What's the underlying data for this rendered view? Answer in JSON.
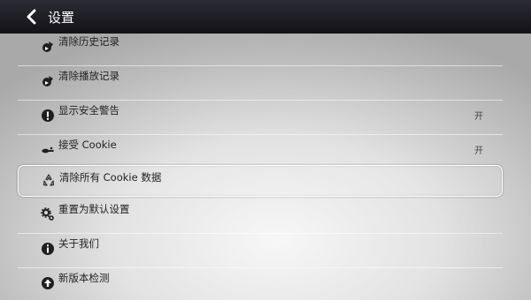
{
  "header": {
    "title": "设置",
    "back_icon": "chevron-left-icon"
  },
  "settings": {
    "items": [
      {
        "label": "清除历史记录",
        "sublabel": "",
        "value": "",
        "icon": "trash-icon"
      },
      {
        "label": "清除播放记录",
        "sublabel": "",
        "value": "",
        "icon": "trash-icon"
      },
      {
        "label": "显示安全警告",
        "sublabel": "",
        "value": "开",
        "icon": "alert-icon"
      },
      {
        "label": "接受 Cookie",
        "sublabel": "",
        "value": "开",
        "icon": "cookie-icon"
      },
      {
        "label": "清除所有 Cookie 数据",
        "sublabel": "",
        "value": "",
        "icon": "recycle-icon",
        "selected": true
      },
      {
        "label": "重置为默认设置",
        "sublabel": "",
        "value": "",
        "icon": "gear-icon"
      },
      {
        "label": "关于我们",
        "sublabel": "",
        "value": "",
        "icon": "info-icon"
      },
      {
        "label": "新版本检测",
        "sublabel": "",
        "value": "",
        "icon": "upgrade-icon"
      }
    ]
  },
  "colors": {
    "topbar": "#1a1a20",
    "label": "#222222",
    "selected_border": "#ffffff"
  }
}
